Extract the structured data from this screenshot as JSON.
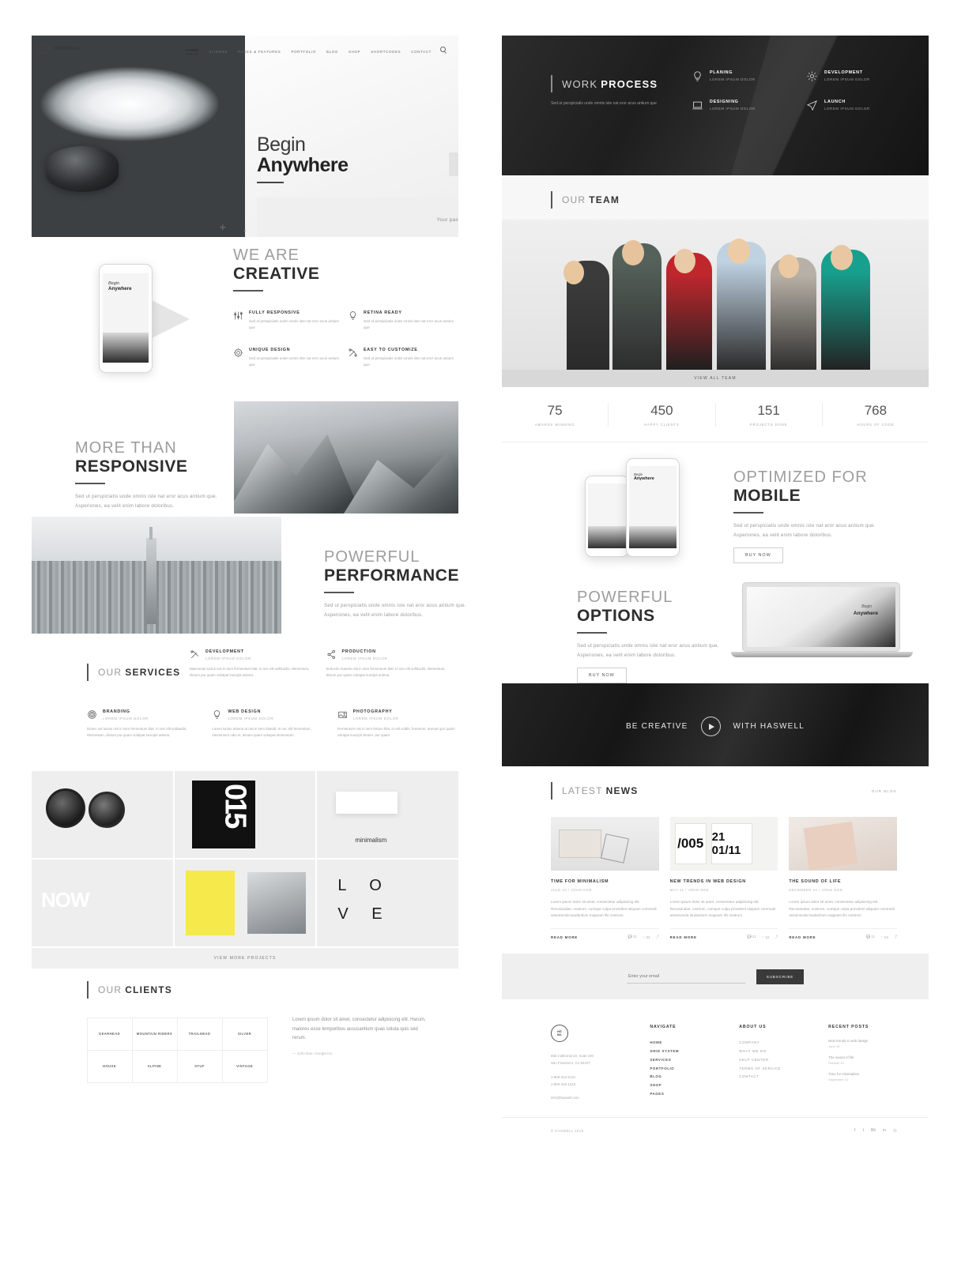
{
  "brand": {
    "name": "HASWELL",
    "mark": "HS\nWL"
  },
  "nav": {
    "items": [
      "HOME",
      "SLIDERS",
      "PAGES & FEATURES",
      "PORTFOLIO",
      "BLOG",
      "SHOP",
      "SHORTCODES",
      "CONTACT"
    ],
    "search_icon": "search-icon"
  },
  "hero": {
    "line1": "Begin",
    "line2": "Anywhere",
    "tagline": "Your passion will guide you"
  },
  "creative": {
    "title_light": "WE ARE",
    "title_bold": "CREATIVE",
    "phone_text_1": "Begin",
    "phone_text_2": "Anywhere",
    "features": [
      {
        "title": "FULLY RESPONSIVE",
        "desc": "Sed ut perspiciatis unde omnis iste nat eror acus antium que",
        "icon": "sliders-icon"
      },
      {
        "title": "RETINA READY",
        "desc": "Sed ut perspiciatis unde omnis iste nat eror acus antium que",
        "icon": "lightbulb-icon"
      },
      {
        "title": "UNIQUE DESIGN",
        "desc": "Sed ut perspiciatis unde omnis iste nat eror acus antium que",
        "icon": "gear-icon"
      },
      {
        "title": "EASY TO CUSTOMIZE",
        "desc": "Sed ut perspiciatis unde omnis iste nat eror acus antium que",
        "icon": "tools-icon"
      }
    ]
  },
  "responsive": {
    "title_light": "MORE THAN",
    "title_bold": "RESPONSIVE",
    "desc": "Sed ut perspiciatis unde omnis iste nat eror acus antium que. Asperiones, ea velit enim labore doloribus."
  },
  "performance": {
    "title_light": "POWERFUL",
    "title_bold": "PERFORMANCE",
    "desc": "Sed ut perspiciatis unde omnis iste nat eror acus antium que. Asperiones, ea velit enim labore doloribus."
  },
  "services": {
    "head_light": "OUR",
    "head_bold": "SERVICES",
    "items": [
      {
        "title": "DEVELOPMENT",
        "sub": "LOREM IPSUM DOLOR",
        "desc": "Maecenas luctus nisi in sem fermentum blat. In nec elit sollixudin, elementum, dictum pur quam volutpat suscipit antena.",
        "icon": "tools-icon"
      },
      {
        "title": "PRODUCTION",
        "sub": "LOREM IPSUM DOLOR",
        "desc": "Seductio maesto nisi in sem fermentum blat. In nec elit sollixudin, elementum, dictum pur quam volutpat suscipit antena.",
        "icon": "share-icon"
      },
      {
        "title": "BRANDING",
        "sub": "LOREM IPSUM DOLOR",
        "desc": "Donec vel luctus nisi in sem fermentum blat. In nec elit sollixudin, elementum, dictum pur quam volutpat suscipit antena.",
        "icon": "target-icon"
      },
      {
        "title": "WEB DESIGN",
        "sub": "LOREM IPSUM DOLOR",
        "desc": "Lorem luctus antena at nisi in sem blandit. In nec elit fermentum, elementum odio et, dictum quam volutpat elementum.",
        "icon": "lightbulb-icon"
      },
      {
        "title": "PHOTOGRAPHY",
        "sub": "LOREM IPSUM DOLOR",
        "desc": "Fermentum nisi in sem fertum blat. In elit soldin, ferentum, arenum pur quam volutpat suscipit dictum. pur quam.",
        "icon": "image-icon"
      }
    ]
  },
  "portfolio": {
    "tiles": [
      {
        "name": "watches",
        "label": ""
      },
      {
        "name": "poster-015",
        "label": "015"
      },
      {
        "name": "minimalism",
        "label": "minimalism"
      },
      {
        "name": "now",
        "label": "NOW"
      },
      {
        "name": "yellow-book",
        "label": ""
      },
      {
        "name": "love",
        "label_1": "L O",
        "label_2": "V E"
      }
    ],
    "view_more": "VIEW MORE PROJECTS"
  },
  "clients": {
    "head_light": "OUR",
    "head_bold": "CLIENTS",
    "logos": [
      "GEARHEAD",
      "MOUNTAIN RIDERS",
      "TRAILHEAD",
      "SILVER",
      "HOUSE",
      "ALPINE",
      "STUF",
      "VINTAGE"
    ],
    "testimonial": "Lorem ipsum dolor sit amet, consectetur adipisicing elit. Harum, maiores esse temporibus accusantium quas soluta quis sed rerum.",
    "author": "— John Doe, Google Inc."
  },
  "work_process": {
    "head_light": "WORK",
    "head_bold": "PROCESS",
    "desc": "Sed ut perspiciatis unde omnis iste nat eror acus antium que",
    "items": [
      {
        "title": "PLANING",
        "sub": "LOREM IPSUM DOLOR",
        "icon": "lightbulb-icon"
      },
      {
        "title": "DEVELOPMENT",
        "sub": "LOREM IPSUM DOLOR",
        "icon": "gear-icon"
      },
      {
        "title": "DESIGNING",
        "sub": "LOREM IPSUM DOLOR",
        "icon": "laptop-icon"
      },
      {
        "title": "LAUNCH",
        "sub": "LOREM IPSUM DOLOR",
        "icon": "paper-plane-icon"
      }
    ]
  },
  "team": {
    "head_light": "OUR",
    "head_bold": "TEAM",
    "view_all": "VIEW ALL TEAM"
  },
  "stats": [
    {
      "number": "75",
      "label": "AWARDS WINNING"
    },
    {
      "number": "450",
      "label": "HAPPY CLIENTS"
    },
    {
      "number": "151",
      "label": "PROJECTS DONE"
    },
    {
      "number": "768",
      "label": "HOURS OF CODE"
    }
  ],
  "mobile": {
    "title_light": "OPTIMIZED FOR",
    "title_bold": "MOBILE",
    "desc": "Sed ut perspiciatis unde omnis iste nat eror acus antium que. Asperiones, ea velit enim labore doloribus.",
    "button": "BUY NOW",
    "phone_text_1": "Begin",
    "phone_text_2": "Anywhere"
  },
  "options": {
    "title_light": "POWERFUL",
    "title_bold": "OPTIONS",
    "desc": "Sed ut perspiciatis unde omnis iste nat eror acus antium que. Asperiones, ea velit enim labore doloribus.",
    "button": "BUY NOW",
    "screen_text_1": "Begin",
    "screen_text_2": "Anywhere"
  },
  "video_cta": {
    "left": "BE CREATIVE",
    "right": "WITH HASWELL",
    "play_icon": "play-icon"
  },
  "news": {
    "head_light": "LATEST",
    "head_bold": "NEWS",
    "our_blog": "OUR BLOG",
    "posts": [
      {
        "title": "TIME FOR MINIMALISM",
        "meta": "JULE 10  /  JOHN DOE",
        "excerpt": "Lorem ipsum dolor sit amet, consectetur adipisicing elit. Recusandae, nostrum, cumque culpa provident aliquam commodi assumenda laudantium magnam illo nostrum.",
        "read_more": "READ MORE",
        "comments": "21",
        "likes": "53"
      },
      {
        "title": "NEW TRENDS IN WEB DESIGN",
        "meta": "MAY 11  /  JOHN DOE",
        "excerpt": "Lorem ipsum dolor sit amet, consectetur adipisicing elit. Recusandae, nostrum, cumque culpa provident aliquam commodi assumenda laudantium magnam illo nostrum.",
        "read_more": "READ MORE",
        "comments": "21",
        "likes": "53"
      },
      {
        "title": "THE SOUND OF LIFE",
        "meta": "DECEMBER 21  /  JOHN DOE",
        "excerpt": "Lorem ipsum dolor sit amet, consectetur adipisicing elit. Recusandae, nostrum, cumque culpa provident aliquam commodi assumenda laudantium magnam illo nostrum.",
        "read_more": "READ MORE",
        "comments": "21",
        "likes": "53"
      }
    ]
  },
  "subscribe": {
    "placeholder": "Enter your email",
    "value": "",
    "button": "SUBSCRIBE"
  },
  "footer": {
    "logo": "HS\nWL",
    "address": "555 California str. Suite 100\nSan Francisco, CA 94107",
    "phone1": "1-800-312-2121",
    "phone2": "1-800-310-1010",
    "email": "info@haswell.com",
    "navigate": {
      "title": "NAVIGATE",
      "items": [
        "HOME",
        "GRID SYSTEM",
        "SERVICES",
        "PORTFOLIO",
        "BLOG",
        "SHOP",
        "PAGES"
      ]
    },
    "about": {
      "title": "ABOUT US",
      "items": [
        "COMPANY",
        "WHAT WE DO",
        "HELP CENTER",
        "TERMS OF SERVICE",
        "CONTACT"
      ]
    },
    "recent": {
      "title": "RECENT POSTS",
      "items": [
        {
          "title": "New trends in web design",
          "date": "June 10"
        },
        {
          "title": "The sound of life",
          "date": "October 10"
        },
        {
          "title": "Time for minimalism",
          "date": "September 21"
        }
      ]
    },
    "copyright": "© HASWELL 2015",
    "socials": [
      "facebook-icon",
      "twitter-icon",
      "behance-icon",
      "linkedin-icon",
      "pinterest-icon"
    ]
  },
  "colors": {
    "dark": "#2b2b2b",
    "accent": "#3a3a3a",
    "muted": "#a4a4a4",
    "light_bg": "#efefef"
  }
}
